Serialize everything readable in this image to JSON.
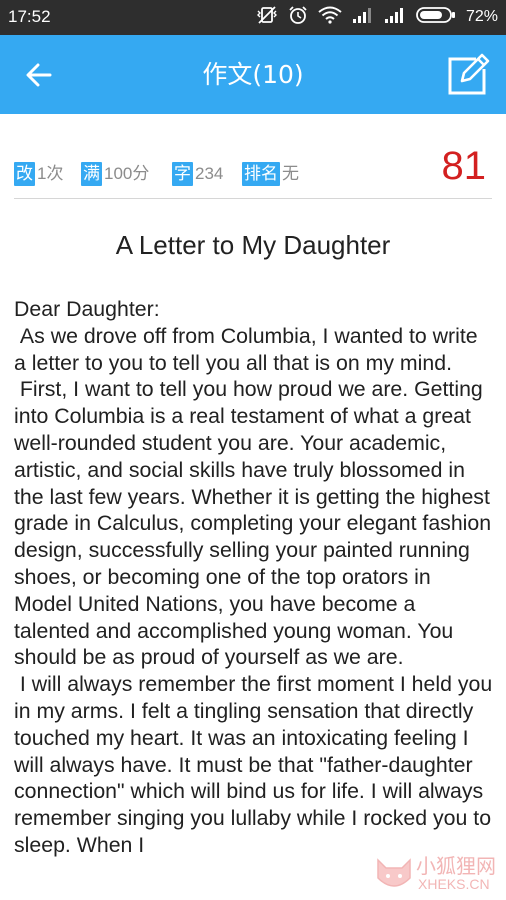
{
  "status_bar": {
    "time": "17:52",
    "battery": "72%"
  },
  "app_bar": {
    "title": "作文(10)",
    "back_icon": "arrow-left-icon",
    "edit_icon": "edit-icon"
  },
  "meta": {
    "revisions": {
      "badge": "改",
      "value": "1次"
    },
    "full_score": {
      "badge": "满",
      "value": "100分"
    },
    "words": {
      "badge": "字",
      "value": "234"
    },
    "rank": {
      "badge": "排名",
      "value": "无"
    },
    "score": "81"
  },
  "essay": {
    "title": "A Letter to My Daughter",
    "paragraphs": [
      "Dear Daughter:",
      " As we drove off from Columbia, I wanted to write a letter to you to tell you all that is on my mind.",
      " First, I want to tell you how proud we are. Getting into Columbia is a real testament of what a great well-rounded student you are. Your academic, artistic, and social skills have truly blossomed in the last few years. Whether it is getting the highest grade in Calculus, completing your elegant fashion design, successfully selling your painted running shoes, or becoming one of the top orators in Model United Nations, you have become a talented and accomplished young woman. You should be as proud of yourself as we are.",
      " I will always remember the first moment I held you in my arms. I felt a tingling sensation that directly touched my heart. It was an intoxicating feeling I will always have. It must be that \"father-daughter connection\" which will bind us for life. I will always remember singing you lullaby while I rocked you to sleep. When I"
    ]
  },
  "watermark": {
    "text": "小狐狸网",
    "url": "XHEKS.CN"
  },
  "colors": {
    "accent": "#35a9f2",
    "score": "#d32020",
    "status_bar": "#2e2e2e"
  }
}
